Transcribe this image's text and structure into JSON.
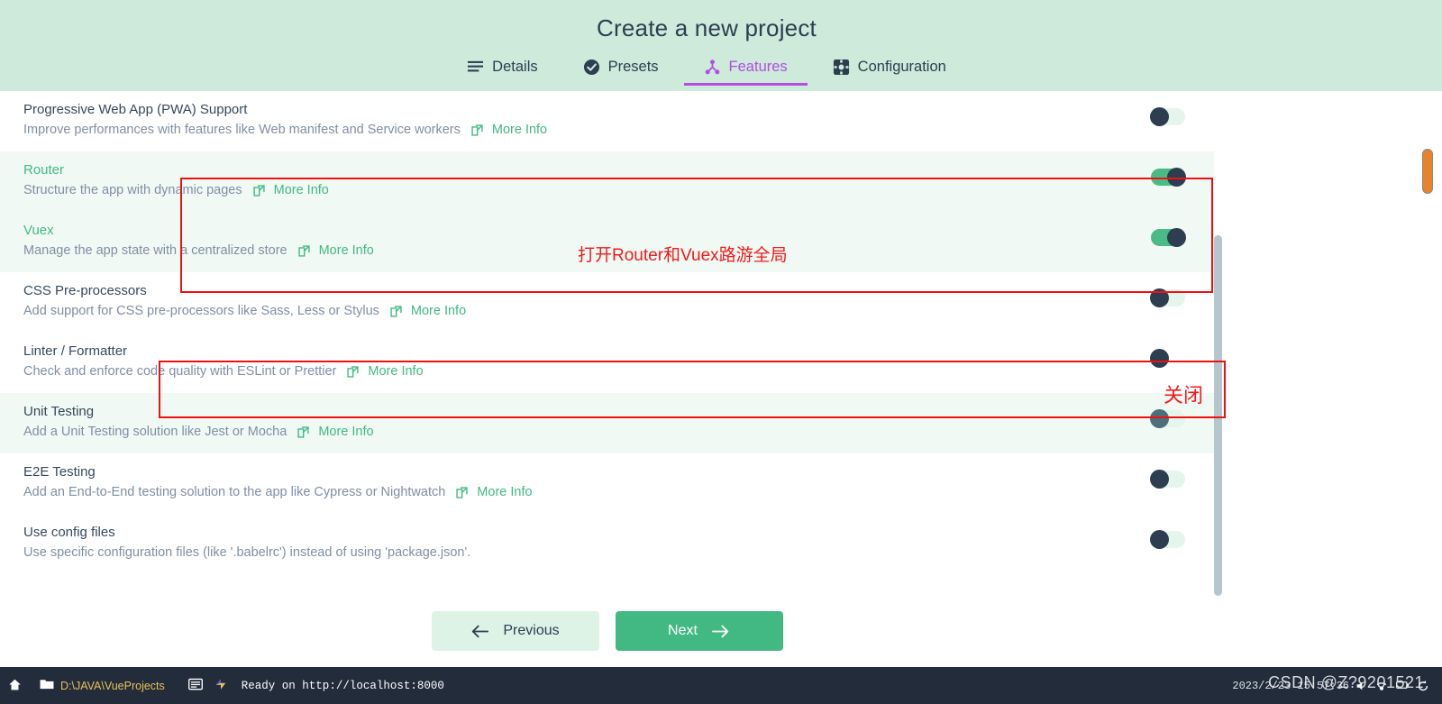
{
  "header": {
    "title": "Create a new project",
    "tabs": [
      {
        "label": "Details",
        "icon": "list-icon",
        "active": false
      },
      {
        "label": "Presets",
        "icon": "check-circle-icon",
        "active": false
      },
      {
        "label": "Features",
        "icon": "node-tree-icon",
        "active": true
      },
      {
        "label": "Configuration",
        "icon": "gear-icon",
        "active": false
      }
    ]
  },
  "features": {
    "more_info_label": "More Info",
    "rows": [
      {
        "title": "Progressive Web App (PWA) Support",
        "desc": "Improve performances with features like Web manifest and Service workers",
        "has_more_info": true,
        "enabled": false,
        "shade": false
      },
      {
        "title": "Router",
        "desc": "Structure the app with dynamic pages",
        "has_more_info": true,
        "enabled": true,
        "shade": true
      },
      {
        "title": "Vuex",
        "desc": "Manage the app state with a centralized store",
        "has_more_info": true,
        "enabled": true,
        "shade": false
      },
      {
        "title": "CSS Pre-processors",
        "desc": "Add support for CSS pre-processors like Sass, Less or Stylus",
        "has_more_info": true,
        "enabled": false,
        "shade": true
      },
      {
        "title": "Linter / Formatter",
        "desc": "Check and enforce code quality with ESLint or Prettier",
        "has_more_info": true,
        "enabled": false,
        "shade": false
      },
      {
        "title": "Unit Testing",
        "desc": "Add a Unit Testing solution like Jest or Mocha",
        "has_more_info": true,
        "enabled": false,
        "shade": true
      },
      {
        "title": "E2E Testing",
        "desc": "Add an End-to-End testing solution to the app like Cypress or Nightwatch",
        "has_more_info": true,
        "enabled": false,
        "shade": false
      },
      {
        "title": "Use config files",
        "desc": "Use specific configuration files (like '.babelrc') instead of using 'package.json'.",
        "has_more_info": false,
        "enabled": false,
        "shade": false
      }
    ]
  },
  "annotations": {
    "router_vuex_note": "打开Router和Vuex路游全局",
    "linter_note": "关闭",
    "color": "#ee1111"
  },
  "footer": {
    "previous_label": "Previous",
    "next_label": "Next"
  },
  "taskbar": {
    "path": "D:\\JAVA\\VueProjects",
    "status": "Ready on http://localhost:8000",
    "clock": "2023/2/23 15:57:36"
  },
  "watermark": {
    "text": "CSDN @Z?9201521"
  },
  "colors": {
    "header_bg": "#cdeadb",
    "accent_purple": "#b44de0",
    "accent_green": "#42b983",
    "row_alt_bg": "#f1f9f4",
    "taskbar_bg": "#222c3a",
    "annotation_red": "#ee1111",
    "scroll_orange": "#e8832a"
  }
}
